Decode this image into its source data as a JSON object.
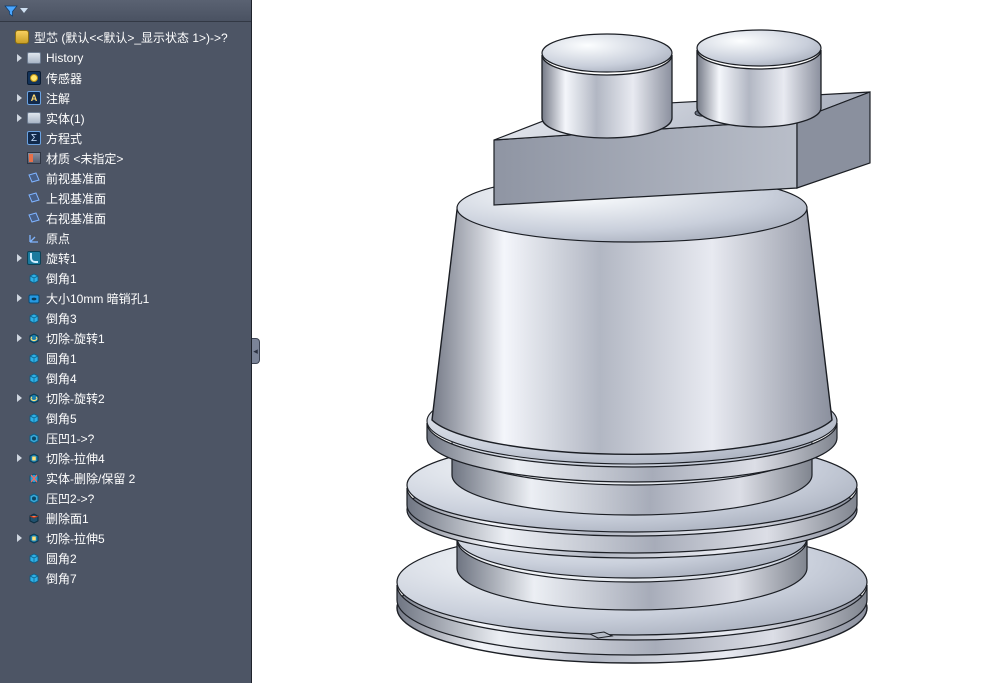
{
  "filter": {
    "tooltip": "过滤"
  },
  "root": {
    "label": "型芯  (默认<<默认>_显示状态 1>)->?"
  },
  "nodes": [
    {
      "exp": true,
      "indent": 1,
      "icon": "folder",
      "name": "history-folder",
      "label": "History"
    },
    {
      "exp": false,
      "indent": 1,
      "icon": "sensor",
      "name": "sensors",
      "label": "传感器"
    },
    {
      "exp": true,
      "indent": 1,
      "icon": "note",
      "name": "annotations",
      "label": "注解"
    },
    {
      "exp": true,
      "indent": 1,
      "icon": "folder",
      "name": "solid-bodies",
      "label": "实体(1)"
    },
    {
      "exp": false,
      "indent": 1,
      "icon": "sigma",
      "name": "equations",
      "label": "方程式"
    },
    {
      "exp": false,
      "indent": 1,
      "icon": "material",
      "name": "material",
      "label": "材质 <未指定>"
    },
    {
      "exp": false,
      "indent": 1,
      "icon": "plane",
      "name": "front-plane",
      "label": "前视基准面"
    },
    {
      "exp": false,
      "indent": 1,
      "icon": "plane",
      "name": "top-plane",
      "label": "上视基准面"
    },
    {
      "exp": false,
      "indent": 1,
      "icon": "plane",
      "name": "right-plane",
      "label": "右视基准面"
    },
    {
      "exp": false,
      "indent": 1,
      "icon": "origin",
      "name": "origin",
      "label": "原点"
    },
    {
      "exp": true,
      "indent": 1,
      "icon": "revolve",
      "name": "revolve1",
      "label": "旋转1"
    },
    {
      "exp": false,
      "indent": 1,
      "icon": "chamfer",
      "name": "chamfer1",
      "label": "倒角1"
    },
    {
      "exp": true,
      "indent": 1,
      "icon": "hole",
      "name": "dowel-hole1",
      "label": "大小10mm 暗销孔1"
    },
    {
      "exp": false,
      "indent": 1,
      "icon": "chamfer",
      "name": "chamfer3",
      "label": "倒角3"
    },
    {
      "exp": true,
      "indent": 1,
      "icon": "cut-rev",
      "name": "cut-revolve1",
      "label": "切除-旋转1"
    },
    {
      "exp": false,
      "indent": 1,
      "icon": "fillet",
      "name": "fillet1",
      "label": "圆角1"
    },
    {
      "exp": false,
      "indent": 1,
      "icon": "chamfer",
      "name": "chamfer4",
      "label": "倒角4"
    },
    {
      "exp": true,
      "indent": 1,
      "icon": "cut-rev",
      "name": "cut-revolve2",
      "label": "切除-旋转2"
    },
    {
      "exp": false,
      "indent": 1,
      "icon": "chamfer",
      "name": "chamfer5",
      "label": "倒角5"
    },
    {
      "exp": false,
      "indent": 1,
      "icon": "indent",
      "name": "indent1",
      "label": "压凹1->?"
    },
    {
      "exp": true,
      "indent": 1,
      "icon": "cut-ext",
      "name": "cut-extrude4",
      "label": "切除-拉伸4"
    },
    {
      "exp": false,
      "indent": 1,
      "icon": "delbody",
      "name": "body-delete2",
      "label": "实体-删除/保留 2"
    },
    {
      "exp": false,
      "indent": 1,
      "icon": "indent",
      "name": "indent2",
      "label": "压凹2->?"
    },
    {
      "exp": false,
      "indent": 1,
      "icon": "delface",
      "name": "delete-face1",
      "label": "删除面1"
    },
    {
      "exp": true,
      "indent": 1,
      "icon": "cut-ext",
      "name": "cut-extrude5",
      "label": "切除-拉伸5"
    },
    {
      "exp": false,
      "indent": 1,
      "icon": "fillet",
      "name": "fillet2",
      "label": "圆角2"
    },
    {
      "exp": false,
      "indent": 1,
      "icon": "chamfer",
      "name": "chamfer7",
      "label": "倒角7"
    }
  ]
}
